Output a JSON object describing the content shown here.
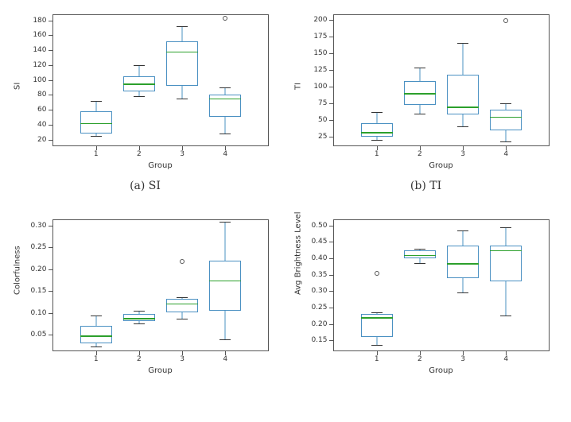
{
  "chart_data": [
    {
      "id": "si",
      "type": "box",
      "xlabel": "Group",
      "ylabel": "SI",
      "yticks": [
        20,
        40,
        60,
        80,
        100,
        120,
        140,
        160,
        180
      ],
      "ylim": [
        12,
        188
      ],
      "categories": [
        "1",
        "2",
        "3",
        "4"
      ],
      "boxes": [
        {
          "whisker_low": 25,
          "q1": 28,
          "median": 42,
          "q3": 58,
          "whisker_high": 72,
          "outliers": []
        },
        {
          "whisker_low": 78,
          "q1": 85,
          "median": 95,
          "q3": 105,
          "whisker_high": 120,
          "outliers": []
        },
        {
          "whisker_low": 75,
          "q1": 92,
          "median": 138,
          "q3": 152,
          "whisker_high": 172,
          "outliers": []
        },
        {
          "whisker_low": 28,
          "q1": 50,
          "median": 75,
          "q3": 80,
          "whisker_high": 90,
          "outliers": [
            183
          ]
        }
      ],
      "caption": "(a) SI"
    },
    {
      "id": "ti",
      "type": "box",
      "xlabel": "Group",
      "ylabel": "TI",
      "yticks": [
        25,
        50,
        75,
        100,
        125,
        150,
        175,
        200
      ],
      "ylim": [
        12,
        208
      ],
      "categories": [
        "1",
        "2",
        "3",
        "4"
      ],
      "boxes": [
        {
          "whisker_low": 20,
          "q1": 25,
          "median": 32,
          "q3": 45,
          "whisker_high": 62,
          "outliers": []
        },
        {
          "whisker_low": 60,
          "q1": 72,
          "median": 90,
          "q3": 108,
          "whisker_high": 128,
          "outliers": []
        },
        {
          "whisker_low": 40,
          "q1": 58,
          "median": 70,
          "q3": 118,
          "whisker_high": 165,
          "outliers": []
        },
        {
          "whisker_low": 18,
          "q1": 35,
          "median": 55,
          "q3": 65,
          "whisker_high": 75,
          "outliers": [
            198
          ]
        }
      ],
      "caption": "(b) TI"
    },
    {
      "id": "colorfulness",
      "type": "box",
      "xlabel": "Group",
      "ylabel": "Colorfulness",
      "yticks": [
        0.05,
        0.1,
        0.15,
        0.2,
        0.25,
        0.3
      ],
      "ylim": [
        0.015,
        0.315
      ],
      "categories": [
        "1",
        "2",
        "3",
        "4"
      ],
      "boxes": [
        {
          "whisker_low": 0.024,
          "q1": 0.03,
          "median": 0.048,
          "q3": 0.07,
          "whisker_high": 0.094,
          "outliers": []
        },
        {
          "whisker_low": 0.076,
          "q1": 0.082,
          "median": 0.088,
          "q3": 0.098,
          "whisker_high": 0.105,
          "outliers": []
        },
        {
          "whisker_low": 0.086,
          "q1": 0.102,
          "median": 0.122,
          "q3": 0.132,
          "whisker_high": 0.136,
          "outliers": [
            0.218
          ]
        },
        {
          "whisker_low": 0.04,
          "q1": 0.105,
          "median": 0.175,
          "q3": 0.22,
          "whisker_high": 0.308,
          "outliers": []
        }
      ],
      "caption": ""
    },
    {
      "id": "brightness",
      "type": "box",
      "xlabel": "Group",
      "ylabel": "Avg Brightness Level",
      "yticks": [
        0.15,
        0.2,
        0.25,
        0.3,
        0.35,
        0.4,
        0.45,
        0.5
      ],
      "ylim": [
        0.12,
        0.52
      ],
      "categories": [
        "1",
        "2",
        "3",
        "4"
      ],
      "boxes": [
        {
          "whisker_low": 0.135,
          "q1": 0.16,
          "median": 0.22,
          "q3": 0.23,
          "whisker_high": 0.235,
          "outliers": [
            0.355
          ]
        },
        {
          "whisker_low": 0.385,
          "q1": 0.4,
          "median": 0.41,
          "q3": 0.425,
          "whisker_high": 0.43,
          "outliers": []
        },
        {
          "whisker_low": 0.295,
          "q1": 0.34,
          "median": 0.385,
          "q3": 0.44,
          "whisker_high": 0.485,
          "outliers": []
        },
        {
          "whisker_low": 0.225,
          "q1": 0.33,
          "median": 0.425,
          "q3": 0.44,
          "whisker_high": 0.495,
          "outliers": []
        }
      ],
      "caption": ""
    }
  ]
}
